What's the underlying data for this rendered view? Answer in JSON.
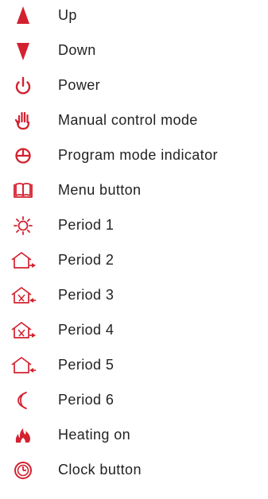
{
  "accent_color": "#d3212f",
  "items": [
    {
      "icon": "triangle-up-icon",
      "label": "Up"
    },
    {
      "icon": "triangle-down-icon",
      "label": "Down"
    },
    {
      "icon": "power-icon",
      "label": "Power"
    },
    {
      "icon": "hand-icon",
      "label": "Manual control mode"
    },
    {
      "icon": "clock-half-icon",
      "label": "Program mode indicator"
    },
    {
      "icon": "book-icon",
      "label": "Menu button"
    },
    {
      "icon": "sun-icon",
      "label": "Period 1"
    },
    {
      "icon": "house-arrow-right-icon",
      "label": "Period 2"
    },
    {
      "icon": "house-fork-knife-arrow-left-icon",
      "label": "Period 3"
    },
    {
      "icon": "house-fork-knife-arrow-right-icon",
      "label": "Period 4"
    },
    {
      "icon": "house-arrow-left-icon",
      "label": "Period 5"
    },
    {
      "icon": "moon-icon",
      "label": "Period 6"
    },
    {
      "icon": "flame-icon",
      "label": "Heating on"
    },
    {
      "icon": "clock-icon",
      "label": "Clock button"
    }
  ]
}
